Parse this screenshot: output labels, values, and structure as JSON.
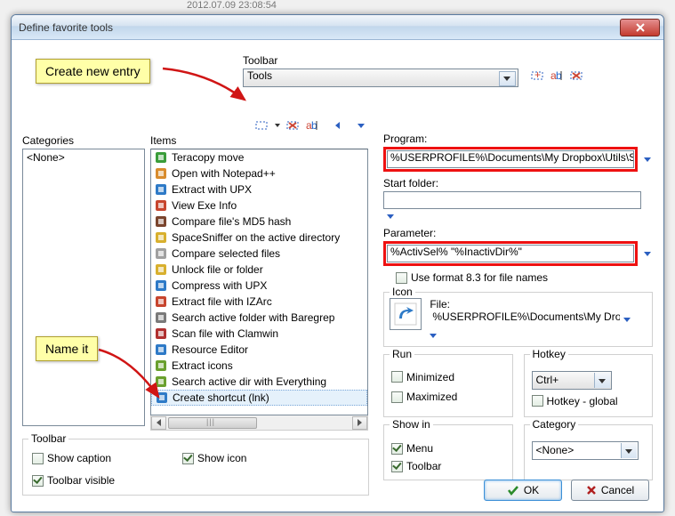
{
  "backdrop_timestamp": "2012.07.09 23:08:54",
  "window": {
    "title": "Define favorite tools"
  },
  "toolbar": {
    "label": "Toolbar",
    "selected": "Tools"
  },
  "annotations": {
    "create_entry": "Create new entry",
    "name_it": "Name it"
  },
  "categories": {
    "label": "Categories",
    "items": [
      "<None>"
    ]
  },
  "items": {
    "label": "Items",
    "list": [
      "Teracopy move",
      "Open with Notepad++",
      "Extract with UPX",
      "View Exe Info",
      "Compare file's MD5 hash",
      "SpaceSniffer on the active directory",
      "Compare selected files",
      "Unlock file or folder",
      "Compress with UPX",
      "Extract file with IZArc",
      "Search active folder with Baregrep",
      "Scan file with Clamwin",
      "Resource Editor",
      "Extract icons",
      "Search active dir with Everything",
      "Create shortcut (lnk)"
    ],
    "selected_index": 15
  },
  "props": {
    "program": {
      "label": "Program:",
      "value": "%USERPROFILE%\\Documents\\My Dropbox\\Utils\\Scrip"
    },
    "start_folder": {
      "label": "Start folder:",
      "value": ""
    },
    "parameter": {
      "label": "Parameter:",
      "value": "%ActivSel% \"%InactivDir%\""
    },
    "format83": {
      "label": "Use format 8.3 for file names",
      "checked": false
    },
    "icon_group": {
      "label": "Icon",
      "file_label": "File:",
      "file_value": "%USERPROFILE%\\Documents\\My Dro"
    },
    "run": {
      "label": "Run",
      "minimized": {
        "label": "Minimized",
        "checked": false
      },
      "maximized": {
        "label": "Maximized",
        "checked": false
      }
    },
    "hotkey": {
      "label": "Hotkey",
      "value": "Ctrl+",
      "global": {
        "label": "Hotkey - global",
        "checked": false
      }
    },
    "showin": {
      "label": "Show in",
      "menu": {
        "label": "Menu",
        "checked": true
      },
      "toolbar": {
        "label": "Toolbar",
        "checked": true
      }
    },
    "category": {
      "label": "Category",
      "value": "<None>"
    }
  },
  "bottom_toolbar": {
    "label": "Toolbar",
    "show_caption": {
      "label": "Show caption",
      "checked": false
    },
    "show_icon": {
      "label": "Show icon",
      "checked": true
    },
    "toolbar_visible": {
      "label": "Toolbar visible",
      "checked": true
    }
  },
  "buttons": {
    "ok": "OK",
    "cancel": "Cancel"
  },
  "icon_colors": [
    "#3a9d3a",
    "#d88c2e",
    "#2e7ac7",
    "#c7452e",
    "#7a452e",
    "#d8b02e",
    "#a0a0a0",
    "#d8b02e",
    "#2e7ac7",
    "#c7452e",
    "#7a7a7a",
    "#b03030",
    "#2e7ac7",
    "#6aa02e",
    "#6aa02e",
    "#2e7ac7"
  ]
}
